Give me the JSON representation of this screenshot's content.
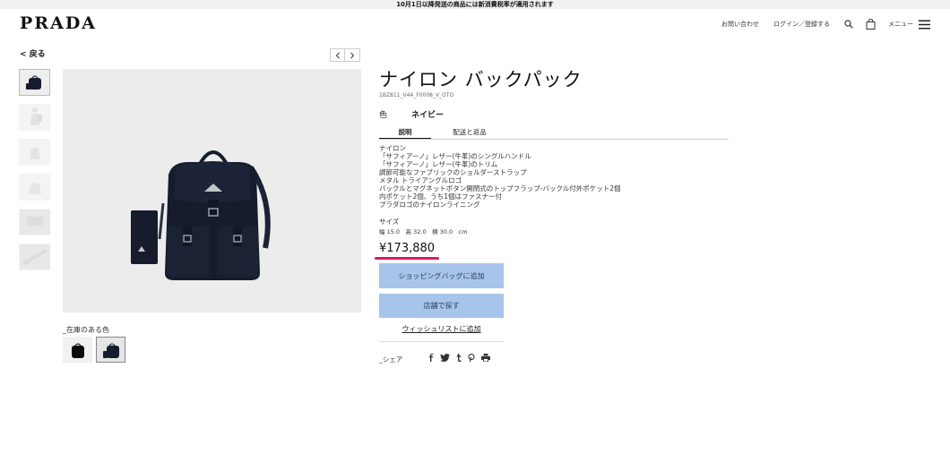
{
  "announcement": "10月1日以降発送の商品には新消費税率が適用されます",
  "brand": "PRADA",
  "nav": {
    "contact": "お問い合わせ",
    "login": "ログイン／登録する",
    "menu": "メニュー"
  },
  "back": "< 戻る",
  "product": {
    "title": "ナイロン バックパック",
    "sku": "1BZ811_V44_F0008_V_OTO",
    "color_label": "色",
    "color_value": "ネイビー",
    "tabs": [
      "説明",
      "配送と返品"
    ],
    "description": [
      "ナイロン",
      "「サフィアーノ」レザー(牛革)のシングルハンドル",
      "「サフィアーノ」レザー(牛革)のトリム",
      "調節可能なファブリックのショルダーストラップ",
      "メタル トライアングルロゴ",
      "バックルとマグネットボタン開閉式のトップフラップ-バックル付外ポケット2個",
      "内ポケット2個、うち1個はファスナー付",
      "プラダロゴのナイロンライニング"
    ],
    "size_label": "サイズ",
    "size_value": "幅 15.0　高 32.0　横 30.0　cm",
    "price": "¥173,880",
    "add_to_bag": "ショッピングバッグに追加",
    "find_store": "店舗で探す",
    "wishlist": "ウィッシュリストに追加",
    "share_label": "_シェア",
    "available_colors_label": "_在庫のある色"
  },
  "colors": {
    "accent_underline": "#d81b60",
    "button_bg": "#a7c4ea",
    "bag": "#161c2c"
  }
}
